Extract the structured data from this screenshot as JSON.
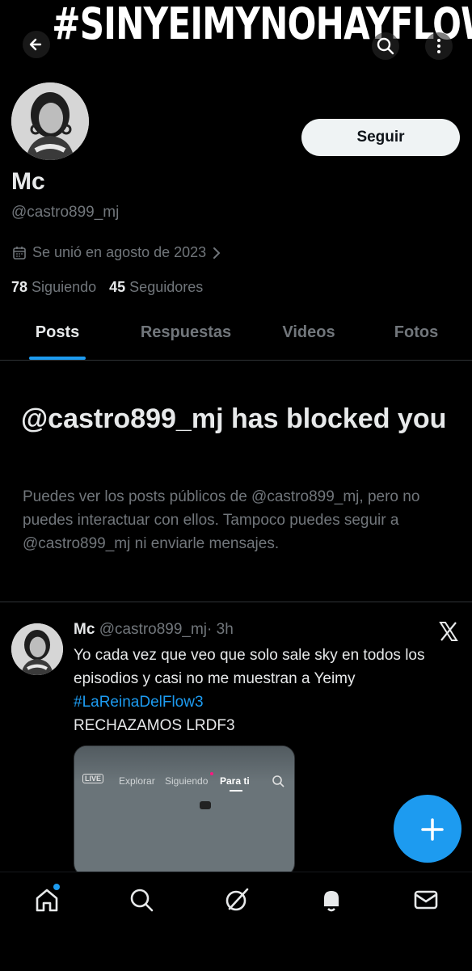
{
  "banner": {
    "text": "#SINYEIMYNOHAYFLOW"
  },
  "header": {
    "back_icon": "arrow-left-icon",
    "search_icon": "search-icon",
    "more_icon": "more-vertical-icon"
  },
  "profile": {
    "name": "Mc",
    "handle": "@castro899_mj",
    "joined": "Se unió en agosto de 2023",
    "following_count": "78",
    "following_label": "Siguiendo",
    "followers_count": "45",
    "followers_label": "Seguidores",
    "follow_button": "Seguir"
  },
  "tabs": [
    {
      "label": "Posts",
      "active": true
    },
    {
      "label": "Respuestas",
      "active": false
    },
    {
      "label": "Videos",
      "active": false
    },
    {
      "label": "Fotos",
      "active": false
    }
  ],
  "blocked": {
    "title": "@castro899_mj has blocked you",
    "body": "Puedes ver los posts públicos de @castro899_mj, pero no puedes interactuar con ellos. Tampoco puedes seguir a @castro899_mj ni enviarle mensajes."
  },
  "post": {
    "name": "Mc",
    "handle": "@castro899_mj",
    "time": "· 3h",
    "text_line1": "Yo cada vez que veo que solo sale sky en todos los episodios y casi no me muestran a Yeimy",
    "hashtag": "#LaReinaDelFlow3",
    "text_line2": "RECHAZAMOS LRDF3",
    "media": {
      "live": "LIVE",
      "tab1": "Explorar",
      "tab2": "Siguiendo",
      "tab3": "Para ti"
    }
  },
  "colors": {
    "accent": "#1d9bf0",
    "muted": "#71767b",
    "text": "#e7e9ea",
    "background": "#000000"
  },
  "nav": [
    "home-icon",
    "search-icon",
    "grok-icon",
    "notifications-icon",
    "messages-icon"
  ]
}
